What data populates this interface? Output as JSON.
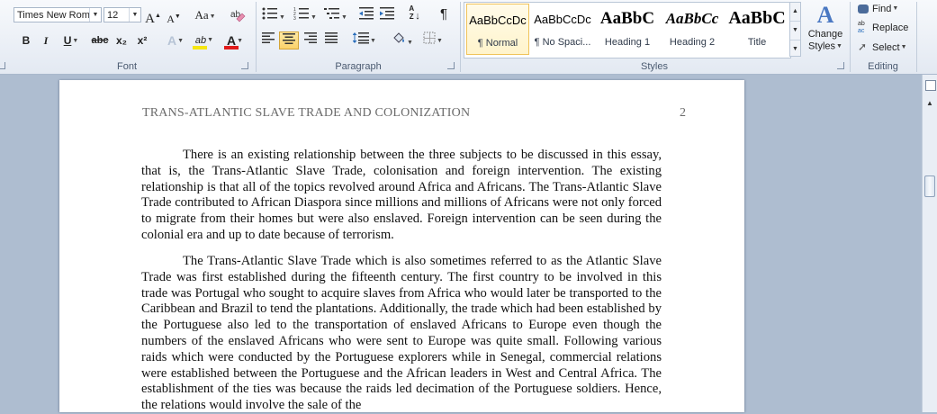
{
  "ribbon": {
    "font": {
      "label": "Font",
      "family": "Times New Rom",
      "size": "12",
      "grow_font": "A",
      "shrink_font": "A",
      "change_case": "Aa",
      "bold": "B",
      "italic": "I",
      "underline": "U",
      "strikethrough": "abc",
      "subscript": "x₂",
      "superscript": "x²",
      "text_effects": "A",
      "highlight": "ab",
      "font_color": "A"
    },
    "paragraph": {
      "label": "Paragraph",
      "sort": "A Z",
      "pilcrow": "¶"
    },
    "styles": {
      "label": "Styles",
      "items": [
        {
          "preview": "AaBbCcDc",
          "name": "¶ Normal"
        },
        {
          "preview": "AaBbCcDc",
          "name": "¶ No Spaci..."
        },
        {
          "preview": "AaBbC",
          "name": "Heading 1"
        },
        {
          "preview": "AaBbCc",
          "name": "Heading 2"
        },
        {
          "preview": "AaBbC",
          "name": "Title"
        }
      ],
      "change_styles_line1": "Change",
      "change_styles_line2": "Styles"
    },
    "editing": {
      "label": "Editing",
      "find": "Find",
      "replace": "Replace",
      "select": "Select"
    },
    "colors": {
      "highlight": "#f5e612",
      "font_color": "#e01b1b",
      "selection": "#fbd26a"
    }
  },
  "document": {
    "header": "TRANS-ATLANTIC SLAVE TRADE AND COLONIZATION",
    "page_number": "2",
    "paragraphs": [
      "There is an existing relationship between the three subjects to be discussed in this essay, that is, the Trans-Atlantic Slave Trade, colonisation and foreign intervention. The existing relationship is that all of the topics revolved around Africa and Africans. The Trans-Atlantic Slave Trade contributed to African Diaspora since millions and millions of Africans were not only forced to migrate from their homes but were also enslaved. Foreign intervention can be seen during the colonial era and up to date because of terrorism.",
      "The Trans-Atlantic Slave Trade which is also sometimes referred to as the Atlantic Slave Trade was first established during the fifteenth century. The first country to be involved in this trade was Portugal who sought to acquire slaves from Africa who would later be transported to the Caribbean and Brazil to tend the plantations. Additionally, the trade which had been established by the Portuguese also led to the transportation of enslaved Africans to Europe even though the numbers of the enslaved Africans who were sent to Europe was quite small. Following various raids which were conducted by the Portuguese explorers while in Senegal, commercial relations were established between the Portuguese and the African leaders in West and Central Africa. The establishment of the ties was because the raids led decimation of the Portuguese soldiers. Hence, the relations would involve the sale of the"
    ]
  }
}
